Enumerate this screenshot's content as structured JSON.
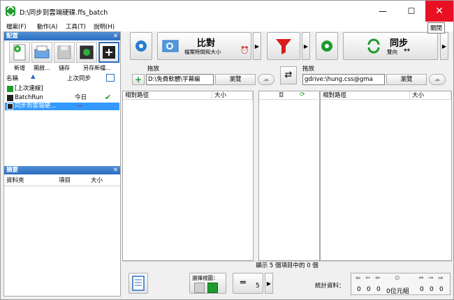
{
  "window": {
    "title": "D:\\同步到雲端硬碟.ffs_batch",
    "close_tooltip": "關閉",
    "minimize_glyph": "—",
    "maximize_glyph": "☐",
    "close_glyph": "✕"
  },
  "menu": [
    "檔案(F)",
    "動作(A)",
    "工具(T)",
    "說明(H)"
  ],
  "config_panel": {
    "title": "配置",
    "close_glyph": "✕",
    "buttons": [
      "新增",
      "開啟...",
      "儲存",
      "另存新檔..."
    ],
    "columns": {
      "name": "名稱",
      "last_sync": "上次同步"
    },
    "rows": [
      {
        "name": "[上次連線]",
        "last_sync": ""
      },
      {
        "name": "BatchRun",
        "last_sync": "今日"
      },
      {
        "name": "同步到雲端硬...",
        "last_sync": "—"
      }
    ]
  },
  "summary_panel": {
    "title": "摘要",
    "close_glyph": "✕",
    "columns": {
      "folder": "資料夾",
      "items": "項目",
      "size": "大小"
    }
  },
  "toolbar": {
    "compare_label": "比對",
    "compare_sub": "檔案時間和大小",
    "sync_label": "同步",
    "sync_sub": "雙向"
  },
  "left_folder": {
    "label": "拖放",
    "path": "D:\\免費軟體\\字幕編",
    "browse": "瀏覽"
  },
  "right_folder": {
    "label": "拖放",
    "path": "gdrive:\\hung.css@gma",
    "browse": "瀏覽"
  },
  "grid": {
    "rel_path": "相對路徑",
    "size": "大小"
  },
  "status": {
    "text": "顯示 5 個項目中的 0 個"
  },
  "bottom": {
    "view_label": "選擇視圖：",
    "count": "5",
    "stats_label": "統計資料：",
    "stats_values": [
      "0",
      "0",
      "0",
      "0位元組",
      "0",
      "0",
      "0"
    ]
  },
  "colors": {
    "accent": "#2a6cc0",
    "close_red": "#e81123",
    "selection": "#3399ff",
    "green": "#1e9a2e"
  }
}
